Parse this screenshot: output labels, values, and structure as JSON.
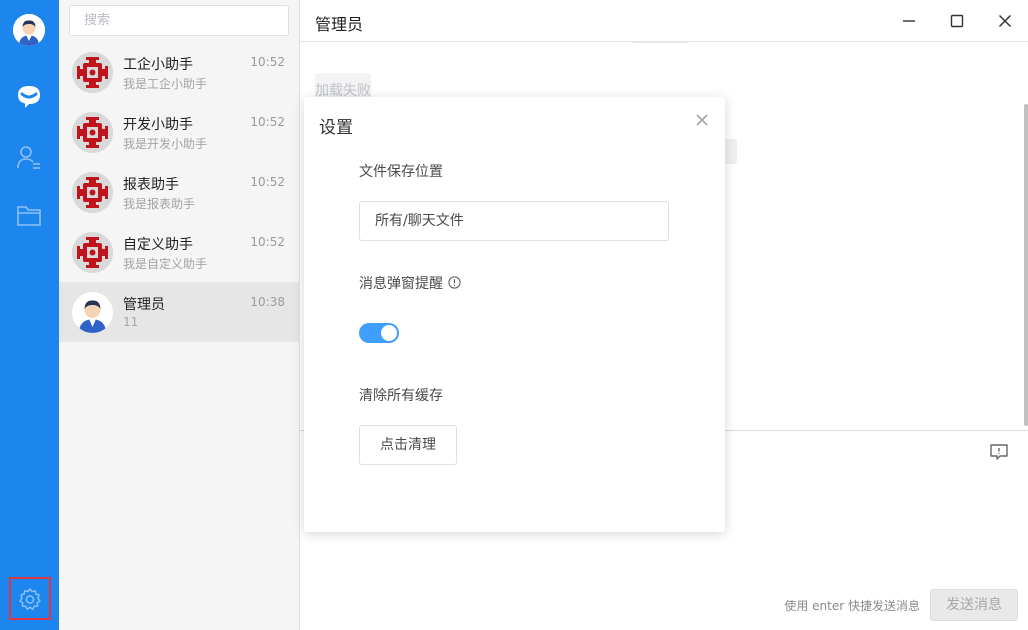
{
  "search": {
    "placeholder": "搜索"
  },
  "conversations": [
    {
      "name": "工企小助手",
      "message": "我是工企小助手",
      "time": "10:52"
    },
    {
      "name": "开发小助手",
      "message": "我是开发小助手",
      "time": "10:52"
    },
    {
      "name": "报表助手",
      "message": "我是报表助手",
      "time": "10:52"
    },
    {
      "name": "自定义助手",
      "message": "我是自定义助手",
      "time": "10:52"
    },
    {
      "name": "管理员",
      "message": "11",
      "time": "10:38"
    }
  ],
  "chat": {
    "title": "管理员",
    "load_failed": "加载失败",
    "send_hint": "使用 enter 快捷发送消息",
    "send_label": "发送消息"
  },
  "settings": {
    "title": "设置",
    "save_location_label": "文件保存位置",
    "save_location_value": "所有/聊天文件",
    "popup_label": "消息弹窗提醒",
    "popup_enabled": true,
    "clear_cache_label": "清除所有缓存",
    "clear_button": "点击清理"
  },
  "colors": {
    "rail": "#1c86ee",
    "toggle_on": "#409eff",
    "settings_highlight": "#e5343b",
    "bot_avatar": "#c0141c"
  }
}
